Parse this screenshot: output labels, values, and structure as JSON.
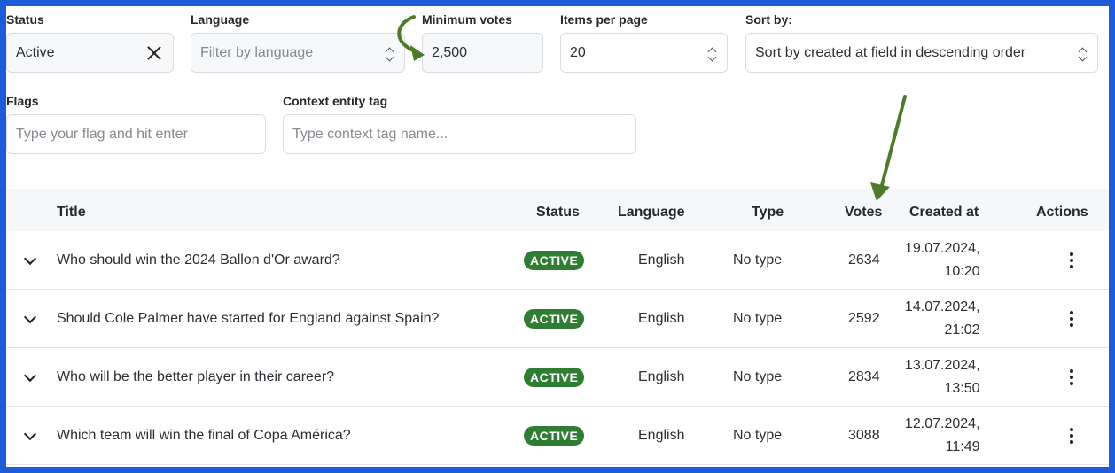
{
  "filters": {
    "status": {
      "label": "Status",
      "value": "Active"
    },
    "language": {
      "label": "Language",
      "placeholder": "Filter by language"
    },
    "min_votes": {
      "label": "Minimum votes",
      "value": "2,500"
    },
    "items_per_page": {
      "label": "Items per page",
      "value": "20"
    },
    "sort_by": {
      "label": "Sort by:",
      "value": "Sort by created at field in descending order"
    },
    "flags": {
      "label": "Flags",
      "placeholder": "Type your flag and hit enter"
    },
    "context_tag": {
      "label": "Context entity tag",
      "placeholder": "Type context tag name..."
    }
  },
  "table": {
    "headers": {
      "title": "Title",
      "status": "Status",
      "language": "Language",
      "type": "Type",
      "votes": "Votes",
      "created_at": "Created at",
      "actions": "Actions"
    },
    "rows": [
      {
        "title": "Who should win the 2024 Ballon d'Or award?",
        "status": "ACTIVE",
        "language": "English",
        "type": "No type",
        "votes": "2634",
        "date": "19.07.2024,",
        "time": "10:20"
      },
      {
        "title": "Should Cole Palmer have started for England against Spain?",
        "status": "ACTIVE",
        "language": "English",
        "type": "No type",
        "votes": "2592",
        "date": "14.07.2024,",
        "time": "21:02"
      },
      {
        "title": "Who will be the better player in their career?",
        "status": "ACTIVE",
        "language": "English",
        "type": "No type",
        "votes": "2834",
        "date": "13.07.2024,",
        "time": "13:50"
      },
      {
        "title": "Which team will win the final of Copa América?",
        "status": "ACTIVE",
        "language": "English",
        "type": "No type",
        "votes": "3088",
        "date": "12.07.2024,",
        "time": "11:49"
      }
    ]
  },
  "colors": {
    "frame_border": "#1e5bd8",
    "badge_active": "#2e7d32",
    "annotation_arrow": "#4f7a2a"
  }
}
